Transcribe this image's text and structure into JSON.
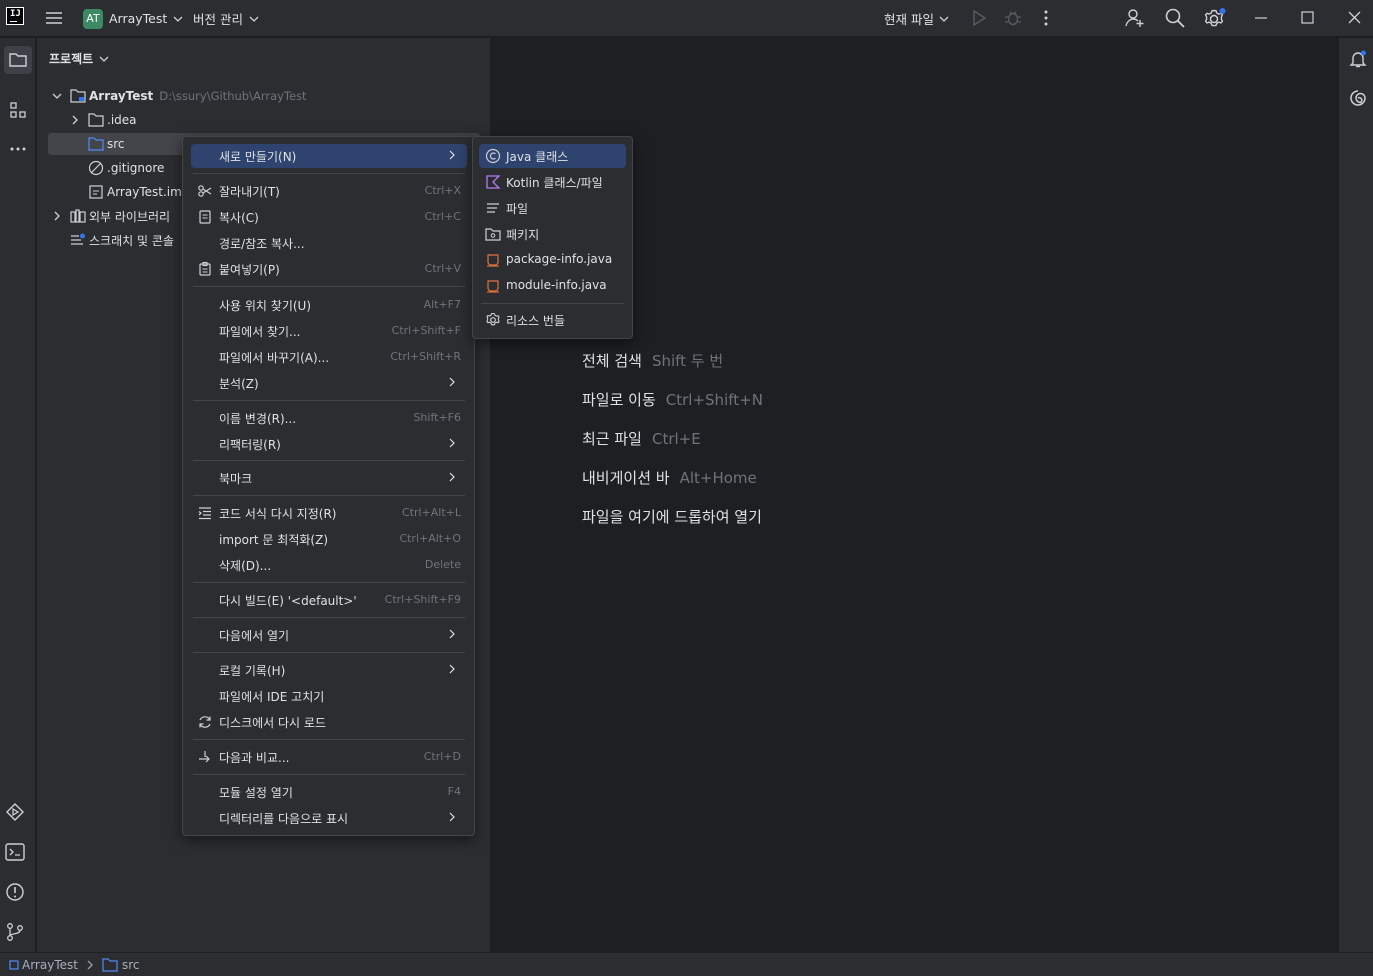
{
  "titlebar": {
    "project_badge": "AT",
    "project_name": "ArrayTest",
    "vcs_label": "버전 관리",
    "run_config": "현재 파일"
  },
  "project_panel": {
    "title": "프로젝트",
    "tree": [
      {
        "label": "ArrayTest",
        "path": "D:\\ssury\\Github\\ArrayTest"
      },
      {
        "label": ".idea"
      },
      {
        "label": "src"
      },
      {
        "label": ".gitignore"
      },
      {
        "label": "ArrayTest.iml"
      },
      {
        "label": "외부 라이브러리"
      },
      {
        "label": "스크래치 및 콘솔"
      }
    ]
  },
  "editor_hints": [
    {
      "label": "전체 검색",
      "shortcut": "Shift 두 번"
    },
    {
      "label": "파일로 이동",
      "shortcut": "Ctrl+Shift+N"
    },
    {
      "label": "최근 파일",
      "shortcut": "Ctrl+E"
    },
    {
      "label": "내비게이션 바",
      "shortcut": "Alt+Home"
    },
    {
      "label": "파일을 여기에 드롭하여 열기",
      "shortcut": ""
    }
  ],
  "context_menu": {
    "items": [
      {
        "label": "새로 만들기(N)",
        "shortcut": ""
      },
      {
        "label": "잘라내기(T)",
        "shortcut": "Ctrl+X"
      },
      {
        "label": "복사(C)",
        "shortcut": "Ctrl+C"
      },
      {
        "label": "경로/참조 복사...",
        "shortcut": ""
      },
      {
        "label": "붙여넣기(P)",
        "shortcut": "Ctrl+V"
      },
      {
        "label": "사용 위치 찾기(U)",
        "shortcut": "Alt+F7"
      },
      {
        "label": "파일에서 찾기...",
        "shortcut": "Ctrl+Shift+F"
      },
      {
        "label": "파일에서 바꾸기(A)...",
        "shortcut": "Ctrl+Shift+R"
      },
      {
        "label": "분석(Z)",
        "shortcut": ""
      },
      {
        "label": "이름 변경(R)...",
        "shortcut": "Shift+F6"
      },
      {
        "label": "리팩터링(R)",
        "shortcut": ""
      },
      {
        "label": "북마크",
        "shortcut": ""
      },
      {
        "label": "코드 서식 다시 지정(R)",
        "shortcut": "Ctrl+Alt+L"
      },
      {
        "label": "import 문 최적화(Z)",
        "shortcut": "Ctrl+Alt+O"
      },
      {
        "label": "삭제(D)...",
        "shortcut": "Delete"
      },
      {
        "label": "다시 빌드(E) '<default>'",
        "shortcut": "Ctrl+Shift+F9"
      },
      {
        "label": "다음에서 열기",
        "shortcut": ""
      },
      {
        "label": "로컬 기록(H)",
        "shortcut": ""
      },
      {
        "label": "파일에서 IDE 고치기",
        "shortcut": ""
      },
      {
        "label": "디스크에서 다시 로드",
        "shortcut": ""
      },
      {
        "label": "다음과 비교...",
        "shortcut": "Ctrl+D"
      },
      {
        "label": "모듈 설정 열기",
        "shortcut": "F4"
      },
      {
        "label": "디렉터리를 다음으로 표시",
        "shortcut": ""
      }
    ]
  },
  "submenu": {
    "items": [
      {
        "label": "Java 클래스"
      },
      {
        "label": "Kotlin 클래스/파일"
      },
      {
        "label": "파일"
      },
      {
        "label": "패키지"
      },
      {
        "label": "package-info.java"
      },
      {
        "label": "module-info.java"
      },
      {
        "label": "리소스 번들"
      }
    ]
  },
  "statusbar": {
    "crumbs": [
      "ArrayTest",
      "src"
    ]
  },
  "colors": {
    "accent": "#2e436e",
    "badge": "#3b8a63",
    "background": "#1e1f22",
    "panel": "#2b2d30"
  }
}
